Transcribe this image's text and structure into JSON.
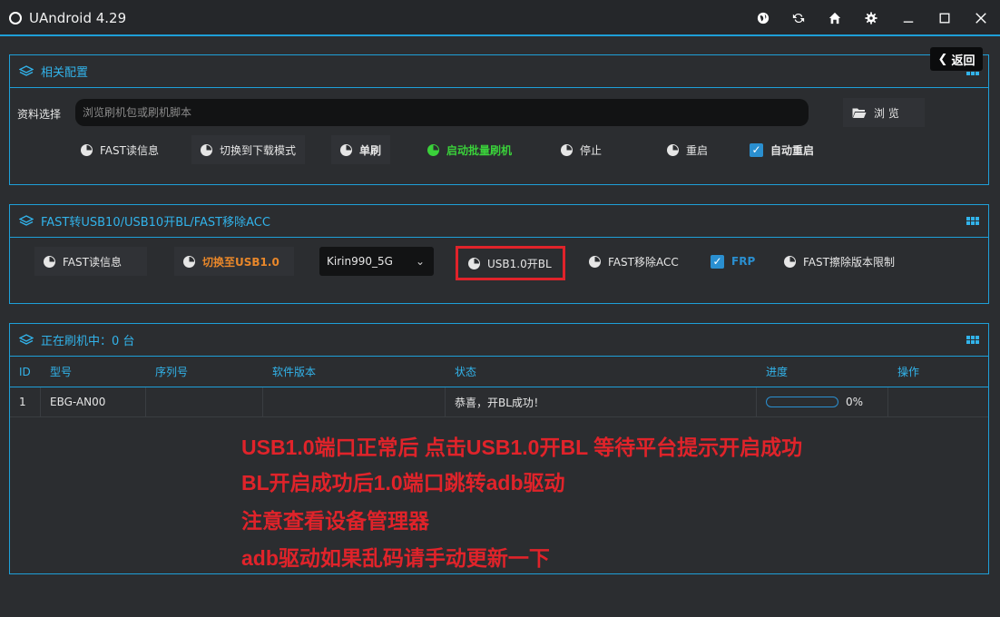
{
  "window": {
    "title": "UAndroid 4.29",
    "icons": [
      "globe-icon",
      "refresh-icon",
      "home-icon",
      "gear-icon",
      "minimize-icon",
      "maximize-icon",
      "close-icon"
    ]
  },
  "back_button": {
    "label": "返回"
  },
  "config_panel": {
    "title": "相关配置",
    "file_label": "资料选择",
    "file_placeholder": "浏览刷机包或刷机脚本",
    "browse_label": "浏 览",
    "buttons": {
      "fast_read": "FAST读信息",
      "switch_download": "切换到下载模式",
      "single_flash": "单刷",
      "batch_flash": "启动批量刷机",
      "stop": "停止",
      "reboot": "重启",
      "auto_reboot": "自动重启"
    },
    "auto_reboot_checked": true
  },
  "fast_panel": {
    "title": "FAST转USB10/USB10开BL/FAST移除ACC",
    "buttons": {
      "fast_read": "FAST读信息",
      "switch_usb": "切换至USB1.0",
      "usb_unlock": "USB1.0开BL",
      "fast_remove_acc": "FAST移除ACC",
      "frp": "FRP",
      "fast_erase_limit": "FAST擦除版本限制"
    },
    "chipset_selected": "Kirin990_5G",
    "frp_checked": true
  },
  "flash_panel": {
    "title": "正在刷机中：0 台",
    "columns": [
      "ID",
      "型号",
      "序列号",
      "软件版本",
      "状态",
      "进度",
      "操作"
    ],
    "rows": [
      {
        "id": "1",
        "model": "EBG-AN00",
        "serial": "",
        "version": "",
        "status": "恭喜，开BL成功！",
        "progress_text": "0%",
        "progress": 0,
        "action": ""
      }
    ]
  },
  "annotations": [
    "USB1.0端口正常后 点击USB1.0开BL 等待平台提示开启成功",
    "BL开启成功后1.0端口跳转adb驱动",
    "注意查看设备管理器",
    "adb驱动如果乱码请手动更新一下"
  ],
  "colors": {
    "accent": "#1e9fd8",
    "header_text": "#32b3ea",
    "batch_green": "#3ad13a",
    "switch_orange": "#e8872a",
    "annotation_red": "#e0232a",
    "checkbox_blue": "#2a8fd0"
  }
}
